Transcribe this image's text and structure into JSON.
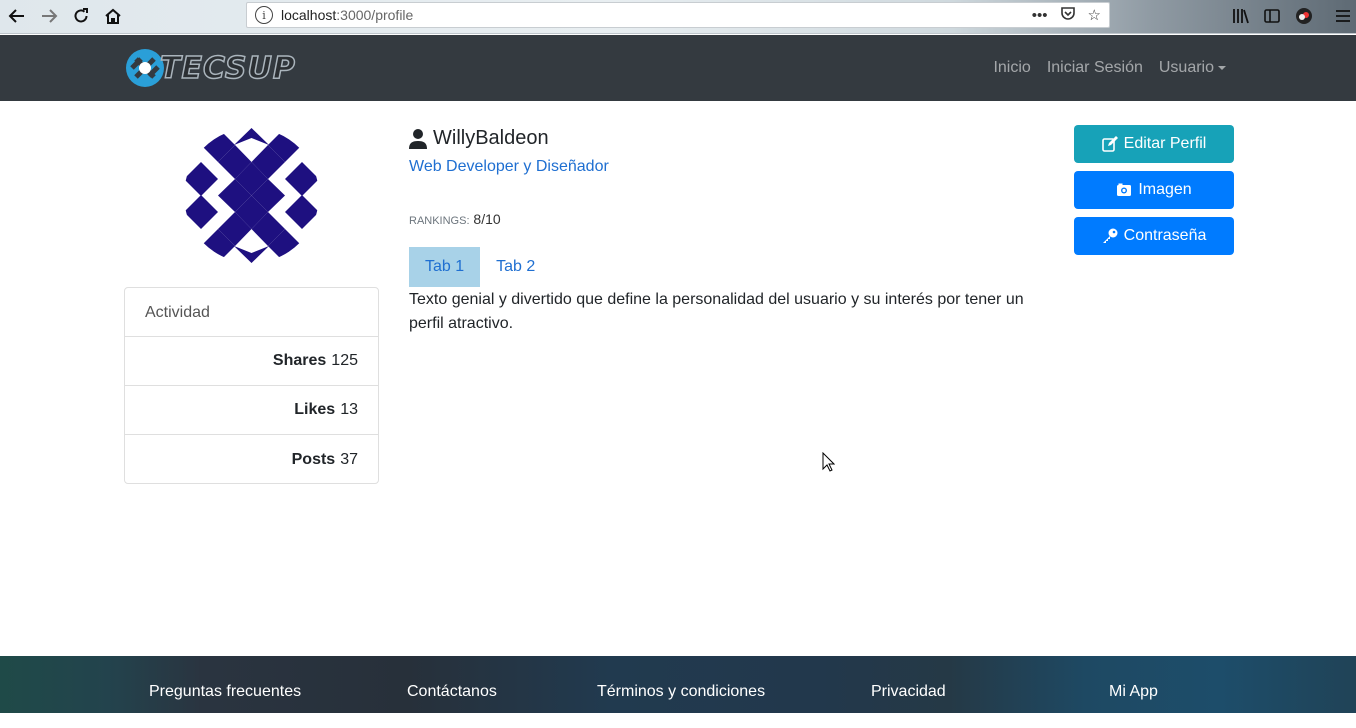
{
  "browser": {
    "url_host": "localhost",
    "url_path": ":3000/profile"
  },
  "navbar": {
    "logo_text": "TECSUP",
    "links": [
      "Inicio",
      "Iniciar Sesión",
      "Usuario"
    ]
  },
  "profile": {
    "username": "WillyBaldeon",
    "role": "Web Developer y Diseñador",
    "rankings_label": "RANKINGS:",
    "rankings_value": "8/10",
    "tabs": [
      "Tab 1",
      "Tab 2"
    ],
    "active_tab": 0,
    "bio": "Texto genial y divertido que define la personalidad del usuario y su interés por tener un perfil atractivo."
  },
  "activity": {
    "title": "Actividad",
    "rows": [
      {
        "label": "Shares",
        "value": "125"
      },
      {
        "label": "Likes",
        "value": "13"
      },
      {
        "label": "Posts",
        "value": "37"
      }
    ]
  },
  "actions": {
    "edit_label": "Editar Perfil",
    "image_label": "Imagen",
    "password_label": "Contraseña"
  },
  "colors": {
    "navbar_bg": "#343a40",
    "info": "#17a2b8",
    "primary": "#007bff",
    "link": "#1f6fd1",
    "active_tab": "#a8d2e8",
    "avatar": "#1e1080"
  },
  "footer": {
    "links": [
      "Preguntas frecuentes",
      "Contáctanos",
      "Términos y condiciones",
      "Privacidad",
      "Mi App"
    ]
  }
}
